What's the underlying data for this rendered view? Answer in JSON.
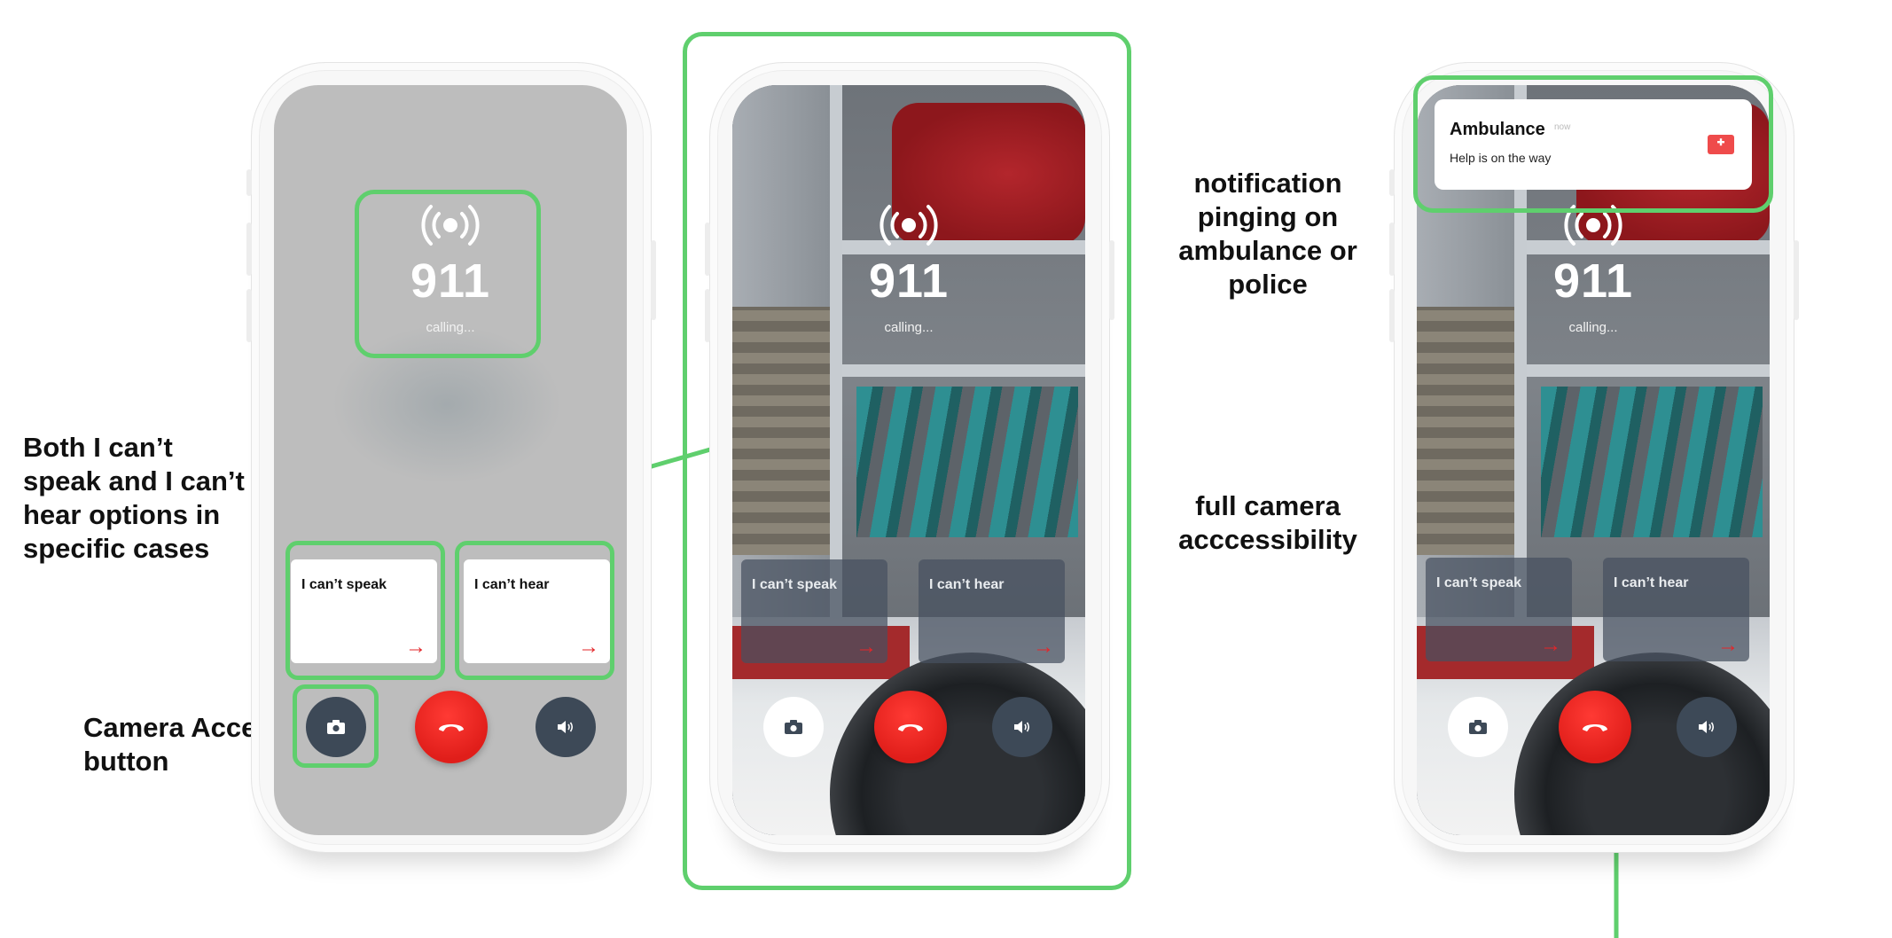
{
  "annotations": {
    "options_note": "Both I can’t\nspeak and I can’t\nhear options in\nspecific cases",
    "camera_note": "Camera Access\nbutton",
    "notification_note": "notification\npinging on\nambulance or\npolice",
    "camera_access_note": "full camera\nacccessibility"
  },
  "call": {
    "number": "911",
    "status": "calling..."
  },
  "options": {
    "cant_speak": "I can’t speak",
    "cant_hear": "I can’t hear",
    "arrow": "→"
  },
  "notification": {
    "title": "Ambulance",
    "time": "now",
    "body": "Help is on the way"
  },
  "icons": {
    "broadcast": "broadcast-icon",
    "camera": "camera-icon",
    "end_call": "phone-hangup-icon",
    "speaker": "speaker-icon",
    "arrow": "arrow-right-icon",
    "ambulance": "ambulance-icon"
  },
  "colors": {
    "highlight": "#5fcf6d",
    "end_call": "#e01e1a",
    "arrow": "#e3262a",
    "dark_button": "#3d4957"
  }
}
